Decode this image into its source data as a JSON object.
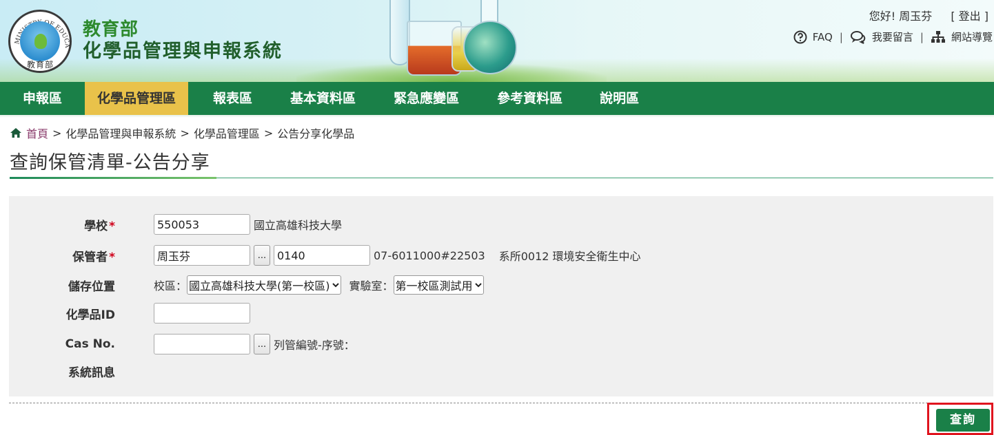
{
  "header": {
    "logo_text": "MINISTRY OF EDUCATION",
    "logo_bottom": "教育部",
    "org_name": "教育部",
    "system_name": "化學品管理與申報系統",
    "greeting": "您好! 周玉芬",
    "logout": "[ 登出 ]",
    "links": [
      {
        "label": "FAQ",
        "icon": "question-circle-icon"
      },
      {
        "label": "我要留言",
        "icon": "chat-bubbles-icon"
      },
      {
        "label": "網站導覽",
        "icon": "sitemap-icon"
      }
    ],
    "separator": "|"
  },
  "nav": {
    "items": [
      "申報區",
      "化學品管理區",
      "報表區",
      "基本資料區",
      "緊急應變區",
      "參考資料區",
      "說明區"
    ],
    "active_index": 1
  },
  "breadcrumb": {
    "home": "首頁",
    "separator": ">",
    "crumbs": [
      "化學品管理與申報系統",
      "化學品管理區",
      "公告分享化學品"
    ]
  },
  "page_title": "查詢保管清單-公告分享",
  "form": {
    "school": {
      "label": "學校",
      "required_mark": "*",
      "value": "550053",
      "name": "國立高雄科技大學"
    },
    "custodian": {
      "label": "保管者",
      "required_mark": "*",
      "name_value": "周玉芬",
      "browse_label": "...",
      "code_value": "0140",
      "phone": "07-6011000#22503",
      "dept": "系所0012 環境安全衛生中心"
    },
    "location": {
      "label": "儲存位置",
      "campus_label": "校區：",
      "campus_selected": "國立高雄科技大學(第一校區)",
      "lab_label": "實驗室：",
      "lab_selected": "第一校區測試用"
    },
    "chemical_id": {
      "label": "化學品ID",
      "value": ""
    },
    "cas": {
      "label": "Cas No.",
      "value": "",
      "browse_label": "...",
      "list_label": "列管編號-序號："
    },
    "system_msg": {
      "label": "系統訊息"
    }
  },
  "actions": {
    "query": "查詢"
  },
  "colors": {
    "nav_bg": "#1a8048",
    "nav_active": "#e9c24a",
    "title_green": "#2e8a2e",
    "highlight": "#e0141e",
    "required": "#d0021b"
  }
}
